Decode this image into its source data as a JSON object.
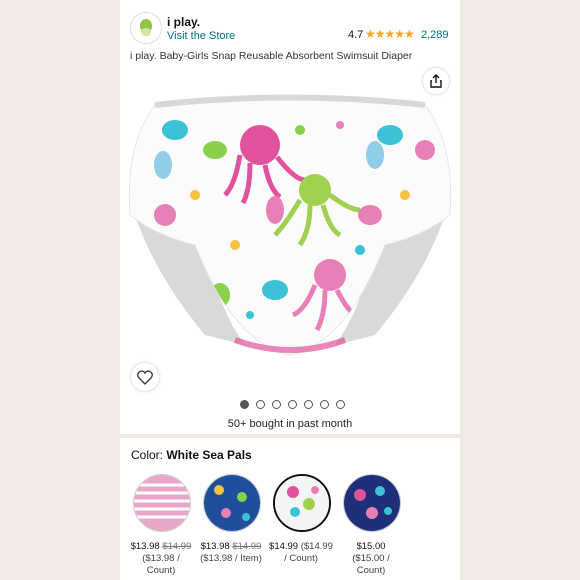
{
  "brand": {
    "name": "i play.",
    "visit": "Visit the Store"
  },
  "rating": {
    "value": "4.7",
    "stars": "★★★★★",
    "count": "2,289"
  },
  "title": "i play. Baby-Girls Snap Reusable Absorbent Swimsuit Diaper",
  "carousel": {
    "count": 7,
    "active": 0
  },
  "bought": "50+ bought in past month",
  "color": {
    "label": "Color:",
    "value": "White Sea Pals"
  },
  "variants": [
    {
      "price": "$13.98",
      "old": "$14.99",
      "unit1": "($13.98 /",
      "unit2": "Count)",
      "color": "#e8a7c9"
    },
    {
      "price": "$13.98",
      "old": "$14.99",
      "unit1": "($13.98 / Item)",
      "unit2": "",
      "color": "#1f4f9c"
    },
    {
      "price": "$14.99",
      "old": "($14.99",
      "unit1": "/ Count)",
      "unit2": "",
      "color": "#f4f4f4"
    },
    {
      "price": "$15.00",
      "old": "",
      "unit1": "($15.00 /",
      "unit2": "Count)",
      "color": "#1f2f7a"
    }
  ]
}
